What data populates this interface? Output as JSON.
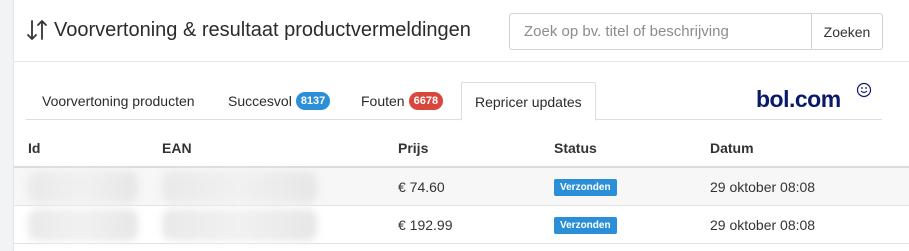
{
  "header": {
    "title": "Voorvertoning & resultaat productvermeldingen",
    "search_placeholder": "Zoek op bv. titel of beschrijving",
    "search_value": "",
    "search_button": "Zoeken"
  },
  "tabs": [
    {
      "label": "Voorvertoning producten",
      "badge": null
    },
    {
      "label": "Succesvol",
      "badge": "8137",
      "badge_color": "#2a8fd6"
    },
    {
      "label": "Fouten",
      "badge": "6678",
      "badge_color": "#d9463c"
    },
    {
      "label": "Repricer updates",
      "badge": null,
      "active": true
    }
  ],
  "logo": {
    "text": "bol.com",
    "color": "#0a1a6b"
  },
  "table": {
    "columns": [
      "Id",
      "EAN",
      "Prijs",
      "Status",
      "Datum"
    ],
    "rows": [
      {
        "id": "",
        "ean": "",
        "prijs": "€ 74.60",
        "status": "Verzonden",
        "datum": "29 oktober 08:08"
      },
      {
        "id": "",
        "ean": "",
        "prijs": "€ 192.99",
        "status": "Verzonden",
        "datum": "29 oktober 08:08"
      }
    ]
  },
  "colors": {
    "accent": "#2a8fd6",
    "error": "#d9463c"
  }
}
